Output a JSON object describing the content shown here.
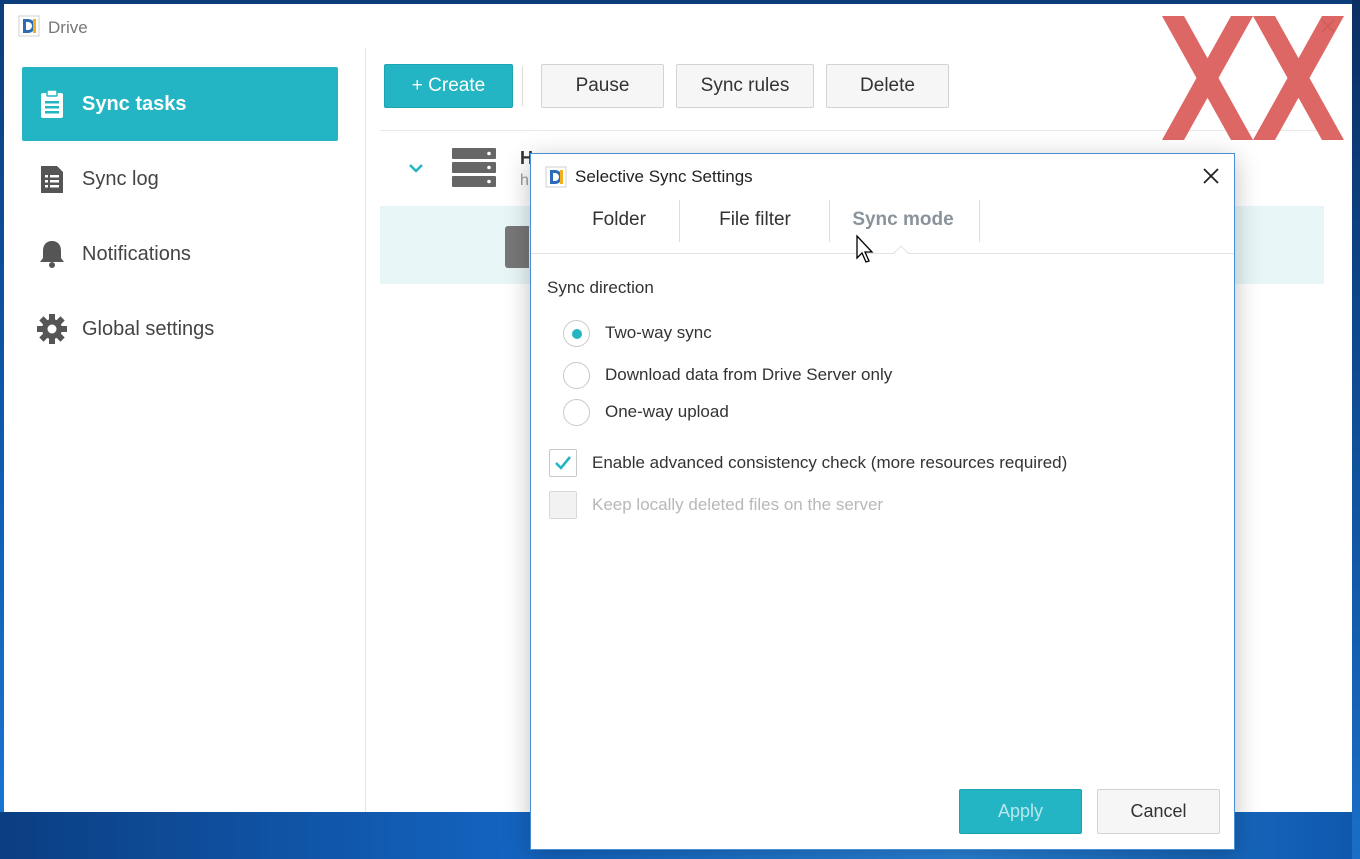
{
  "window": {
    "title": "Drive"
  },
  "sidebar": {
    "items": [
      {
        "label": "Sync tasks",
        "icon": "clipboard-icon",
        "active": true
      },
      {
        "label": "Sync log",
        "icon": "log-list-icon",
        "active": false
      },
      {
        "label": "Notifications",
        "icon": "bell-icon",
        "active": false
      },
      {
        "label": "Global settings",
        "icon": "gear-icon",
        "active": false
      }
    ]
  },
  "toolbar": {
    "create_label": "+ Create",
    "pause_label": "Pause",
    "sync_rules_label": "Sync rules",
    "delete_label": "Delete"
  },
  "task_list": {
    "name_stub": "H",
    "sub_stub": "h"
  },
  "dialog": {
    "title": "Selective Sync Settings",
    "tabs": [
      {
        "label": "Folder",
        "active": false
      },
      {
        "label": "File filter",
        "active": false
      },
      {
        "label": "Sync mode",
        "active": true
      }
    ],
    "section_label": "Sync direction",
    "sync_direction_options": [
      {
        "label": "Two-way sync",
        "selected": true
      },
      {
        "label": "Download data from Drive Server only",
        "selected": false
      },
      {
        "label": "One-way upload",
        "selected": false
      }
    ],
    "checkboxes": [
      {
        "label": "Enable advanced consistency check (more resources required)",
        "checked": true,
        "disabled": false
      },
      {
        "label": "Keep locally deleted files on the server",
        "checked": false,
        "disabled": true
      }
    ],
    "apply_label": "Apply",
    "cancel_label": "Cancel"
  },
  "colors": {
    "accent": "#23b5c3",
    "selected_row": "#e8f6f8",
    "watermark": "#d9534f"
  }
}
